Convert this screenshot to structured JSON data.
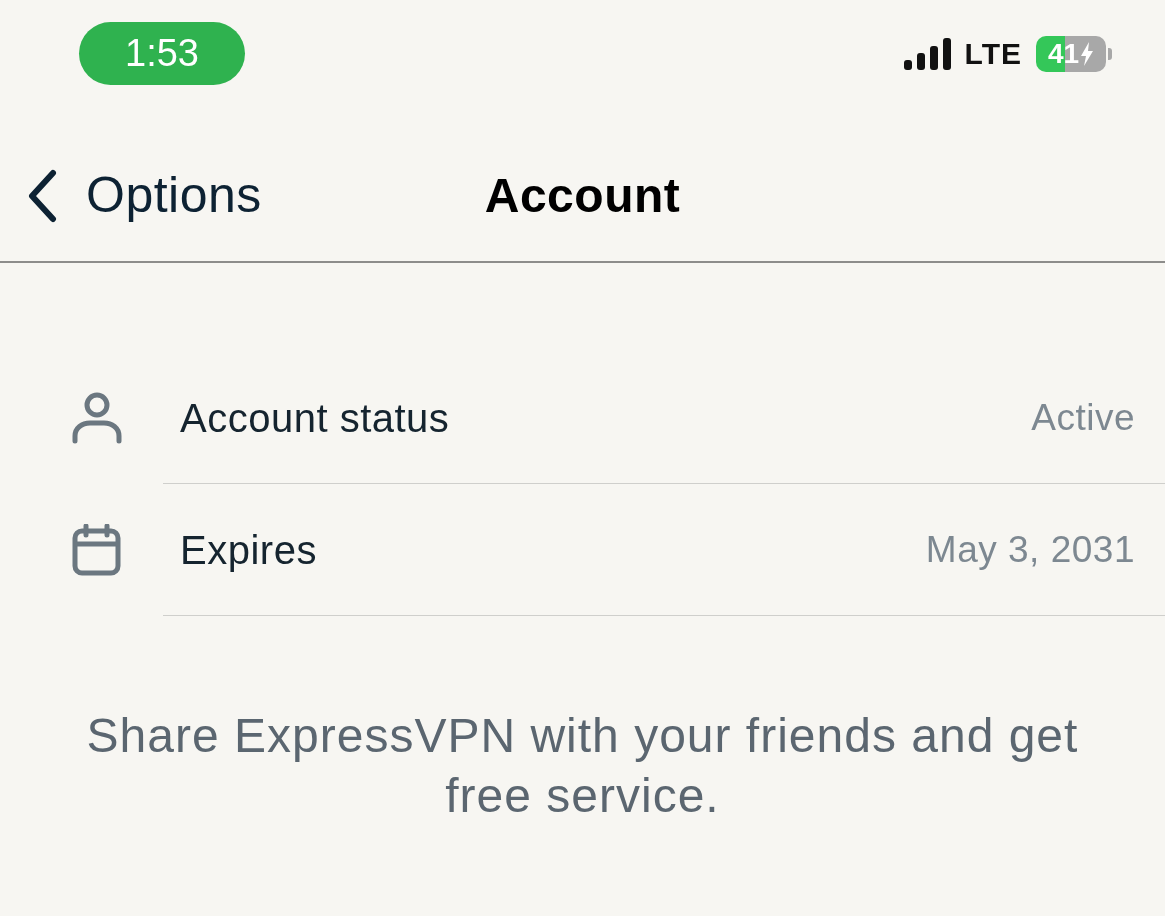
{
  "status_bar": {
    "time": "1:53",
    "network": "LTE",
    "battery": {
      "percent": "41",
      "charging": true
    }
  },
  "nav": {
    "back_label": "Options",
    "title": "Account"
  },
  "rows": [
    {
      "kind": "person",
      "label": "Account status",
      "value": "Active"
    },
    {
      "kind": "calendar",
      "label": "Expires",
      "value": "May 3, 2031"
    }
  ],
  "footer": {
    "text": "Share ExpressVPN with your friends and get free service."
  }
}
